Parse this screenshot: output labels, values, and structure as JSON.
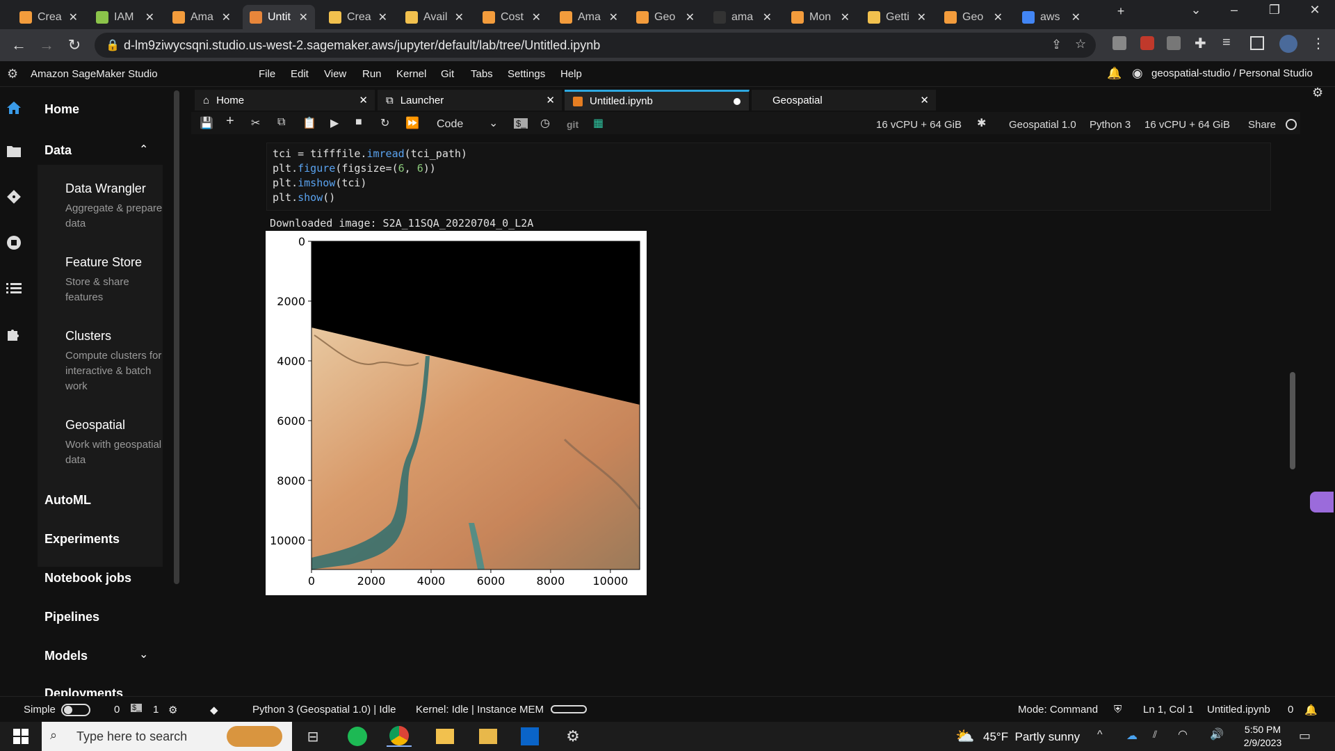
{
  "browser": {
    "tabs": [
      {
        "title": "Crea",
        "color": "#f39c3c"
      },
      {
        "title": "IAM",
        "color": "#8bc34a"
      },
      {
        "title": "Ama",
        "color": "#f39c3c"
      },
      {
        "title": "Untit",
        "color": "#e8863a",
        "active": true
      },
      {
        "title": "Crea",
        "color": "#f2c14e"
      },
      {
        "title": "Avail",
        "color": "#f2c14e"
      },
      {
        "title": "Cost",
        "color": "#f39c3c"
      },
      {
        "title": "Ama",
        "color": "#f39c3c"
      },
      {
        "title": "Geo",
        "color": "#f39c3c"
      },
      {
        "title": "ama",
        "color": "#333333"
      },
      {
        "title": "Mon",
        "color": "#f39c3c"
      },
      {
        "title": "Getti",
        "color": "#f2c14e"
      },
      {
        "title": "Geo",
        "color": "#f39c3c"
      },
      {
        "title": "aws",
        "color": "#4285f4"
      }
    ],
    "url": "d-lm9ziwycsqni.studio.us-west-2.sagemaker.aws/jupyter/default/lab/tree/Untitled.ipynb"
  },
  "studio": {
    "title": "Amazon SageMaker Studio",
    "menu": [
      "File",
      "Edit",
      "View",
      "Run",
      "Kernel",
      "Git",
      "Tabs",
      "Settings",
      "Help"
    ],
    "user": "geospatial-studio / Personal Studio"
  },
  "sidebar": {
    "home": "Home",
    "data": "Data",
    "items": [
      {
        "title": "Data Wrangler",
        "desc": "Aggregate & prepare data"
      },
      {
        "title": "Feature Store",
        "desc": "Store & share features"
      },
      {
        "title": "Clusters",
        "desc": "Compute clusters for interactive & batch work"
      },
      {
        "title": "Geospatial",
        "desc": "Work with geospatial data"
      }
    ],
    "automl": "AutoML",
    "experiments": "Experiments",
    "notebook_jobs": "Notebook jobs",
    "pipelines": "Pipelines",
    "models": "Models",
    "deployments": "Deployments"
  },
  "editor": {
    "tabs": [
      "Home",
      "Launcher",
      "Untitled.ipynb",
      "Geospatial"
    ],
    "cell_type": "Code",
    "instance": "16 vCPU + 64 GiB",
    "image": "Geospatial 1.0",
    "kernel": "Python 3",
    "share": "Share",
    "code_lines": [
      "tci = tifffile.imread(tci_path)",
      "plt.figure(figsize=(6, 6))",
      "plt.imshow(tci)",
      "plt.show()"
    ],
    "output_text": "Downloaded image: S2A_11SQA_20220704_0_L2A"
  },
  "chart_data": {
    "type": "heatmap",
    "title": "",
    "xlabel": "",
    "ylabel": "",
    "x_ticks": [
      0,
      2000,
      4000,
      6000,
      8000,
      10000
    ],
    "y_ticks": [
      0,
      2000,
      4000,
      6000,
      8000,
      10000
    ],
    "xlim": [
      0,
      10980
    ],
    "ylim": [
      10980,
      0
    ],
    "x_tick_labels": [
      "0",
      "2000",
      "4000",
      "6000",
      "8000",
      "10000"
    ],
    "y_tick_labels": [
      "0",
      "2000",
      "4000",
      "6000",
      "8000",
      "10000"
    ]
  },
  "status": {
    "simple": "Simple",
    "n0": "0",
    "n1": "1",
    "kernel_info": "Python 3 (Geospatial 1.0) | Idle",
    "kernel_status": "Kernel: Idle | Instance MEM",
    "mode": "Mode: Command",
    "position": "Ln 1, Col 1",
    "file": "Untitled.ipynb",
    "notif": "0"
  },
  "taskbar": {
    "search": "Type here to search",
    "weather": "45°F  Partly sunny",
    "time": "5:50 PM",
    "date": "2/9/2023"
  }
}
